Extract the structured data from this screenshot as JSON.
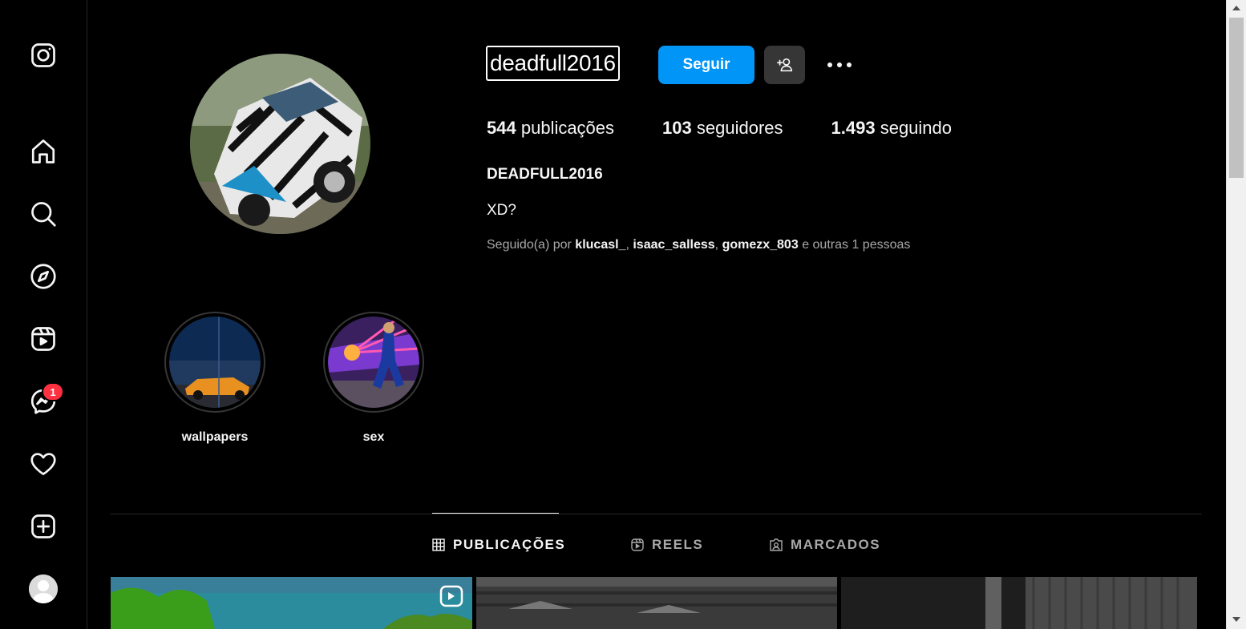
{
  "sidebar": {
    "items": [
      {
        "name": "instagram-logo-icon"
      },
      {
        "name": "home-icon"
      },
      {
        "name": "search-icon"
      },
      {
        "name": "explore-icon"
      },
      {
        "name": "reels-icon"
      },
      {
        "name": "messenger-icon"
      },
      {
        "name": "heart-icon"
      },
      {
        "name": "create-icon"
      }
    ],
    "messages_badge": "1"
  },
  "profile": {
    "username": "deadfull2016",
    "follow_label": "Seguir",
    "stats": {
      "posts_count": "544",
      "posts_label": "publicações",
      "followers_count": "103",
      "followers_label": "seguidores",
      "following_count": "1.493",
      "following_label": "seguindo"
    },
    "full_name": "DEADFULL2016",
    "bio": "XD?",
    "followed_by": {
      "prefix": "Seguido(a) por",
      "accounts": [
        "klucasl_",
        "isaac_salless",
        "gomezx_803"
      ],
      "suffix": "e outras 1 pessoas"
    }
  },
  "highlights": [
    {
      "label": "wallpapers"
    },
    {
      "label": "sex"
    }
  ],
  "tabs": [
    {
      "label": "PUBLICAÇÕES",
      "icon": "grid-icon",
      "active": true
    },
    {
      "label": "REELS",
      "icon": "reels-icon",
      "active": false
    },
    {
      "label": "MARCADOS",
      "icon": "tagged-icon",
      "active": false
    }
  ],
  "colors": {
    "background": "#000000",
    "accent": "#0095f6",
    "badge": "#ff3040",
    "muted_text": "#a8a8a8"
  }
}
